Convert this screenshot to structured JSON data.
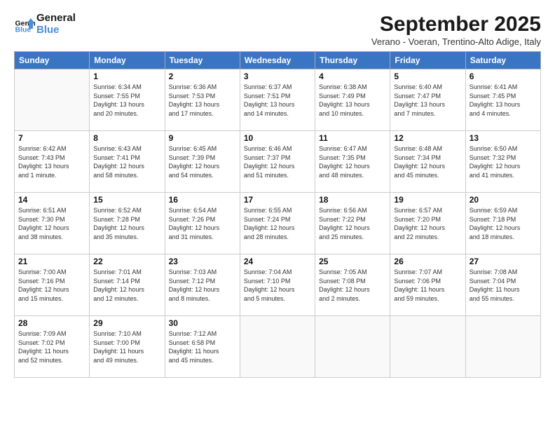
{
  "header": {
    "logo_line1": "General",
    "logo_line2": "Blue",
    "month": "September 2025",
    "location": "Verano - Voeran, Trentino-Alto Adige, Italy"
  },
  "days_of_week": [
    "Sunday",
    "Monday",
    "Tuesday",
    "Wednesday",
    "Thursday",
    "Friday",
    "Saturday"
  ],
  "weeks": [
    [
      {
        "day": "",
        "info": ""
      },
      {
        "day": "1",
        "info": "Sunrise: 6:34 AM\nSunset: 7:55 PM\nDaylight: 13 hours\nand 20 minutes."
      },
      {
        "day": "2",
        "info": "Sunrise: 6:36 AM\nSunset: 7:53 PM\nDaylight: 13 hours\nand 17 minutes."
      },
      {
        "day": "3",
        "info": "Sunrise: 6:37 AM\nSunset: 7:51 PM\nDaylight: 13 hours\nand 14 minutes."
      },
      {
        "day": "4",
        "info": "Sunrise: 6:38 AM\nSunset: 7:49 PM\nDaylight: 13 hours\nand 10 minutes."
      },
      {
        "day": "5",
        "info": "Sunrise: 6:40 AM\nSunset: 7:47 PM\nDaylight: 13 hours\nand 7 minutes."
      },
      {
        "day": "6",
        "info": "Sunrise: 6:41 AM\nSunset: 7:45 PM\nDaylight: 13 hours\nand 4 minutes."
      }
    ],
    [
      {
        "day": "7",
        "info": "Sunrise: 6:42 AM\nSunset: 7:43 PM\nDaylight: 13 hours\nand 1 minute."
      },
      {
        "day": "8",
        "info": "Sunrise: 6:43 AM\nSunset: 7:41 PM\nDaylight: 12 hours\nand 58 minutes."
      },
      {
        "day": "9",
        "info": "Sunrise: 6:45 AM\nSunset: 7:39 PM\nDaylight: 12 hours\nand 54 minutes."
      },
      {
        "day": "10",
        "info": "Sunrise: 6:46 AM\nSunset: 7:37 PM\nDaylight: 12 hours\nand 51 minutes."
      },
      {
        "day": "11",
        "info": "Sunrise: 6:47 AM\nSunset: 7:35 PM\nDaylight: 12 hours\nand 48 minutes."
      },
      {
        "day": "12",
        "info": "Sunrise: 6:48 AM\nSunset: 7:34 PM\nDaylight: 12 hours\nand 45 minutes."
      },
      {
        "day": "13",
        "info": "Sunrise: 6:50 AM\nSunset: 7:32 PM\nDaylight: 12 hours\nand 41 minutes."
      }
    ],
    [
      {
        "day": "14",
        "info": "Sunrise: 6:51 AM\nSunset: 7:30 PM\nDaylight: 12 hours\nand 38 minutes."
      },
      {
        "day": "15",
        "info": "Sunrise: 6:52 AM\nSunset: 7:28 PM\nDaylight: 12 hours\nand 35 minutes."
      },
      {
        "day": "16",
        "info": "Sunrise: 6:54 AM\nSunset: 7:26 PM\nDaylight: 12 hours\nand 31 minutes."
      },
      {
        "day": "17",
        "info": "Sunrise: 6:55 AM\nSunset: 7:24 PM\nDaylight: 12 hours\nand 28 minutes."
      },
      {
        "day": "18",
        "info": "Sunrise: 6:56 AM\nSunset: 7:22 PM\nDaylight: 12 hours\nand 25 minutes."
      },
      {
        "day": "19",
        "info": "Sunrise: 6:57 AM\nSunset: 7:20 PM\nDaylight: 12 hours\nand 22 minutes."
      },
      {
        "day": "20",
        "info": "Sunrise: 6:59 AM\nSunset: 7:18 PM\nDaylight: 12 hours\nand 18 minutes."
      }
    ],
    [
      {
        "day": "21",
        "info": "Sunrise: 7:00 AM\nSunset: 7:16 PM\nDaylight: 12 hours\nand 15 minutes."
      },
      {
        "day": "22",
        "info": "Sunrise: 7:01 AM\nSunset: 7:14 PM\nDaylight: 12 hours\nand 12 minutes."
      },
      {
        "day": "23",
        "info": "Sunrise: 7:03 AM\nSunset: 7:12 PM\nDaylight: 12 hours\nand 8 minutes."
      },
      {
        "day": "24",
        "info": "Sunrise: 7:04 AM\nSunset: 7:10 PM\nDaylight: 12 hours\nand 5 minutes."
      },
      {
        "day": "25",
        "info": "Sunrise: 7:05 AM\nSunset: 7:08 PM\nDaylight: 12 hours\nand 2 minutes."
      },
      {
        "day": "26",
        "info": "Sunrise: 7:07 AM\nSunset: 7:06 PM\nDaylight: 11 hours\nand 59 minutes."
      },
      {
        "day": "27",
        "info": "Sunrise: 7:08 AM\nSunset: 7:04 PM\nDaylight: 11 hours\nand 55 minutes."
      }
    ],
    [
      {
        "day": "28",
        "info": "Sunrise: 7:09 AM\nSunset: 7:02 PM\nDaylight: 11 hours\nand 52 minutes."
      },
      {
        "day": "29",
        "info": "Sunrise: 7:10 AM\nSunset: 7:00 PM\nDaylight: 11 hours\nand 49 minutes."
      },
      {
        "day": "30",
        "info": "Sunrise: 7:12 AM\nSunset: 6:58 PM\nDaylight: 11 hours\nand 45 minutes."
      },
      {
        "day": "",
        "info": ""
      },
      {
        "day": "",
        "info": ""
      },
      {
        "day": "",
        "info": ""
      },
      {
        "day": "",
        "info": ""
      }
    ]
  ]
}
